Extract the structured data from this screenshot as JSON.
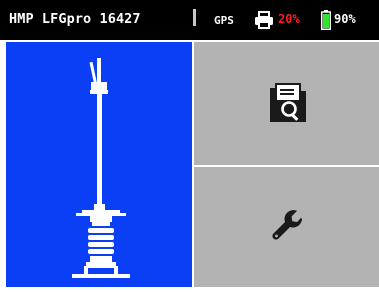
{
  "status_bar": {
    "title": "HMP LFGpro 16427",
    "gps_label": "GPS",
    "printer_percent": "20%",
    "battery_percent": "90%",
    "icons": [
      "printer-icon",
      "battery-icon"
    ],
    "colors": {
      "background": "#000000",
      "printer_warning": "#ff1e1e",
      "battery": "#2ee62e",
      "text": "#ffffff"
    }
  },
  "tiles": [
    {
      "name": "device-tile",
      "icon": "penetrometer-device-illustration",
      "color": "#0a3ff5"
    },
    {
      "name": "documents-tile",
      "icon": "documents-search-icon",
      "color": "#b3b3b3"
    },
    {
      "name": "settings-tile",
      "icon": "wrench-icon",
      "color": "#b3b3b3"
    }
  ]
}
